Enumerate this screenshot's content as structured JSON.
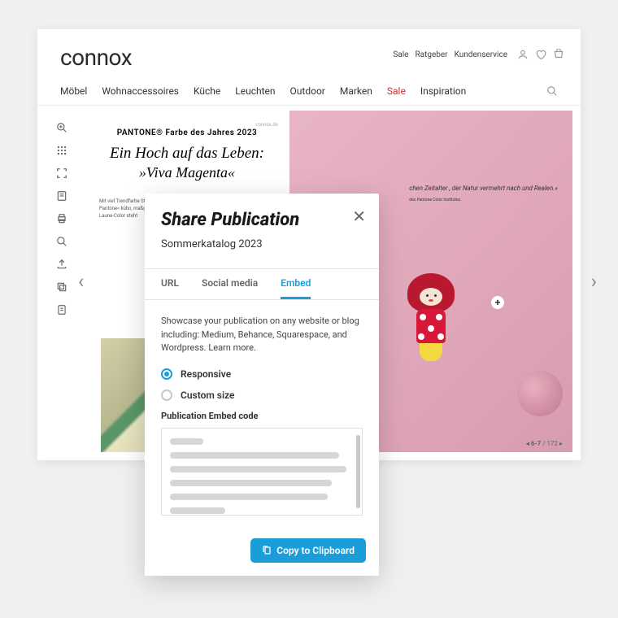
{
  "header": {
    "logo": "connox",
    "top_links": [
      "Sale",
      "Ratgeber",
      "Kundenservice"
    ],
    "nav": [
      "Möbel",
      "Wohnaccessoires",
      "Küche",
      "Leuchten",
      "Outdoor",
      "Marken",
      "Sale",
      "Inspiration"
    ]
  },
  "spread": {
    "brand": "connox.de",
    "title": "PANTONE® Farbe des Jahres 2023",
    "script_line1": "Ein Hoch auf das Leben:",
    "script_line2": "»Viva Magenta«",
    "body": "Mit viel Trendfarbe Stärke, des Pantone« kühn, maßgebend Laune-Color steht",
    "right_text": "chen Zeitalter , der Natur vermehrt nach und Realen.«",
    "right_caption": "des Pantone Color Institutes.",
    "page_counter_prefix": "◂ 6-7",
    "page_counter_total": " / 172 ▸"
  },
  "modal": {
    "title": "Share Publication",
    "subtitle": "Sommerkatalog 2023",
    "tabs": [
      "URL",
      "Social media",
      "Embed"
    ],
    "description": "Showcase your publication on any website or blog including: Medium, Behance, Squarespace, and Wordpress. Learn more.",
    "option_responsive": "Responsive",
    "option_custom": "Custom size",
    "embed_label": "Publication Embed code",
    "copy_label": "Copy to Clipboard"
  }
}
